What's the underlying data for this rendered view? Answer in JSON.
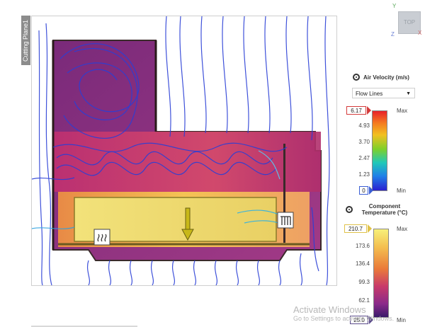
{
  "view": {
    "cutting_plane_label": "Cutting Plane1",
    "cube_label": "TOP",
    "axes": {
      "y": "Y",
      "x": "X",
      "z": "Z"
    }
  },
  "velocity_legend": {
    "title": "Air Velocity (m/s)",
    "display_mode": "Flow Lines",
    "max_value": "6.17",
    "min_value": "0",
    "max_label": "Max",
    "min_label": "Min",
    "ticks": [
      "4.93",
      "3.70",
      "2.47",
      "1.23"
    ]
  },
  "temperature_legend": {
    "title": "Component Temperature (°C)",
    "max_value": "210.7",
    "min_value": "25.0",
    "max_label": "Max",
    "min_label": "Min",
    "ticks": [
      "173.6",
      "136.4",
      "99.3",
      "62.1"
    ]
  },
  "watermark": {
    "title": "Activate Windows",
    "subtitle": "Go to Settings to activate Windows."
  },
  "colors": {
    "flow_lines": "#2a3fd6",
    "panel_border": "#cfcfcf"
  },
  "icons": [
    "gear-icon",
    "chevron-down-icon",
    "heat-source-icon",
    "heat-sink-icon",
    "down-arrow-icon"
  ]
}
